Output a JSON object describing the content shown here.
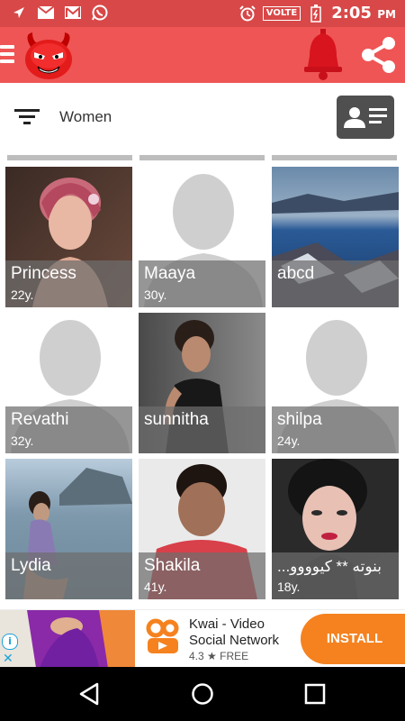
{
  "status_bar": {
    "time": "2:05",
    "ampm": "PM",
    "volte": "VOLTE",
    "left_icons": [
      "navigation-icon",
      "mail-icon",
      "gmail-icon",
      "whatsapp-icon"
    ],
    "right_icons": [
      "alarm-icon",
      "volte-icon",
      "battery-icon"
    ]
  },
  "app_bar": {
    "menu_icon": "hamburger-icon",
    "logo_icon": "devil-logo-icon",
    "notification_icon": "bell-icon",
    "share_icon": "share-icon"
  },
  "filter": {
    "label": "Women",
    "icon": "filter-icon",
    "action_icon": "contact-card-icon"
  },
  "profiles": [
    {
      "name": "Princess",
      "age": "22y."
    },
    {
      "name": "Maaya",
      "age": "30y."
    },
    {
      "name": "abcd",
      "age": ""
    },
    {
      "name": "Revathi",
      "age": "32y."
    },
    {
      "name": "sunnitha",
      "age": ""
    },
    {
      "name": "shilpa",
      "age": "24y."
    },
    {
      "name": "Lydia",
      "age": ""
    },
    {
      "name": "Shakila",
      "age": "41y."
    },
    {
      "name": "...بنوته ** كيوووو",
      "age": "18y."
    }
  ],
  "ad": {
    "title_line1": "Kwai - Video",
    "title_line2": "Social Network",
    "rating": "4.3 ★ FREE",
    "install_label": "INSTALL",
    "info_icon": "info-icon",
    "close_icon": "close-icon"
  },
  "colors": {
    "status_bar": "#d84848",
    "app_bar": "#ef5555",
    "install": "#f5821f"
  }
}
